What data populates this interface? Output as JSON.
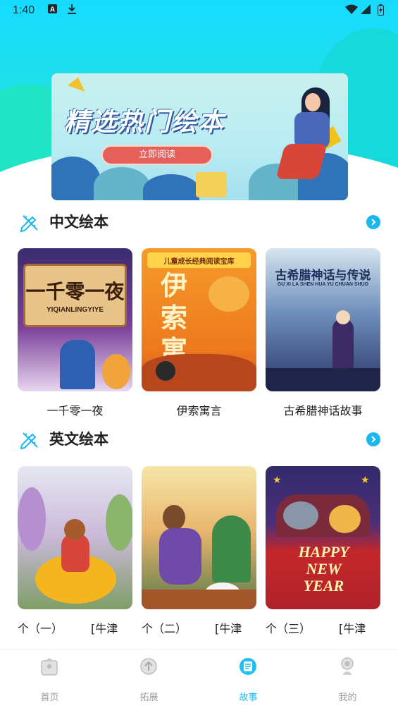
{
  "status_bar": {
    "time": "1:40",
    "icons": [
      "a-notification-icon",
      "download-icon",
      "wifi-icon",
      "signal-icon",
      "battery-icon"
    ]
  },
  "banner": {
    "title": "精选热门绘本",
    "button_label": "立即阅读"
  },
  "sections": [
    {
      "title": "中文绘本",
      "books": [
        {
          "title": "一千零一夜",
          "cover_title": "一千零一夜",
          "cover_subtitle": "YIQIANLINGYIYE"
        },
        {
          "title": "伊索寓言",
          "cover_title": "伊索寓言",
          "cover_banner": "儿童成长经典阅读宝库"
        },
        {
          "title": "古希腊神话故事",
          "cover_title": "古希腊神话与传说",
          "cover_subtitle": "GU XI LA SHEN HUA YU CHUAN SHUO"
        }
      ]
    },
    {
      "title": "英文绘本",
      "books": [
        {
          "title": "个（一）　　　[牛津"
        },
        {
          "title": "个（二）　　　[牛津"
        },
        {
          "title": "个（三）　　　[牛津",
          "cover_text": "HAPPY NEW YEAR"
        }
      ]
    }
  ],
  "tab_bar": {
    "tabs": [
      {
        "label": "首页",
        "icon": "home-icon",
        "active": false
      },
      {
        "label": "拓展",
        "icon": "expand-icon",
        "active": false
      },
      {
        "label": "故事",
        "icon": "story-icon",
        "active": true
      },
      {
        "label": "我的",
        "icon": "profile-icon",
        "active": false
      }
    ]
  },
  "colors": {
    "accent": "#17b6f0",
    "header_gradient_top": "#16dbff",
    "header_gradient_bottom": "#25e7d2",
    "banner_button": "#e5605a"
  }
}
